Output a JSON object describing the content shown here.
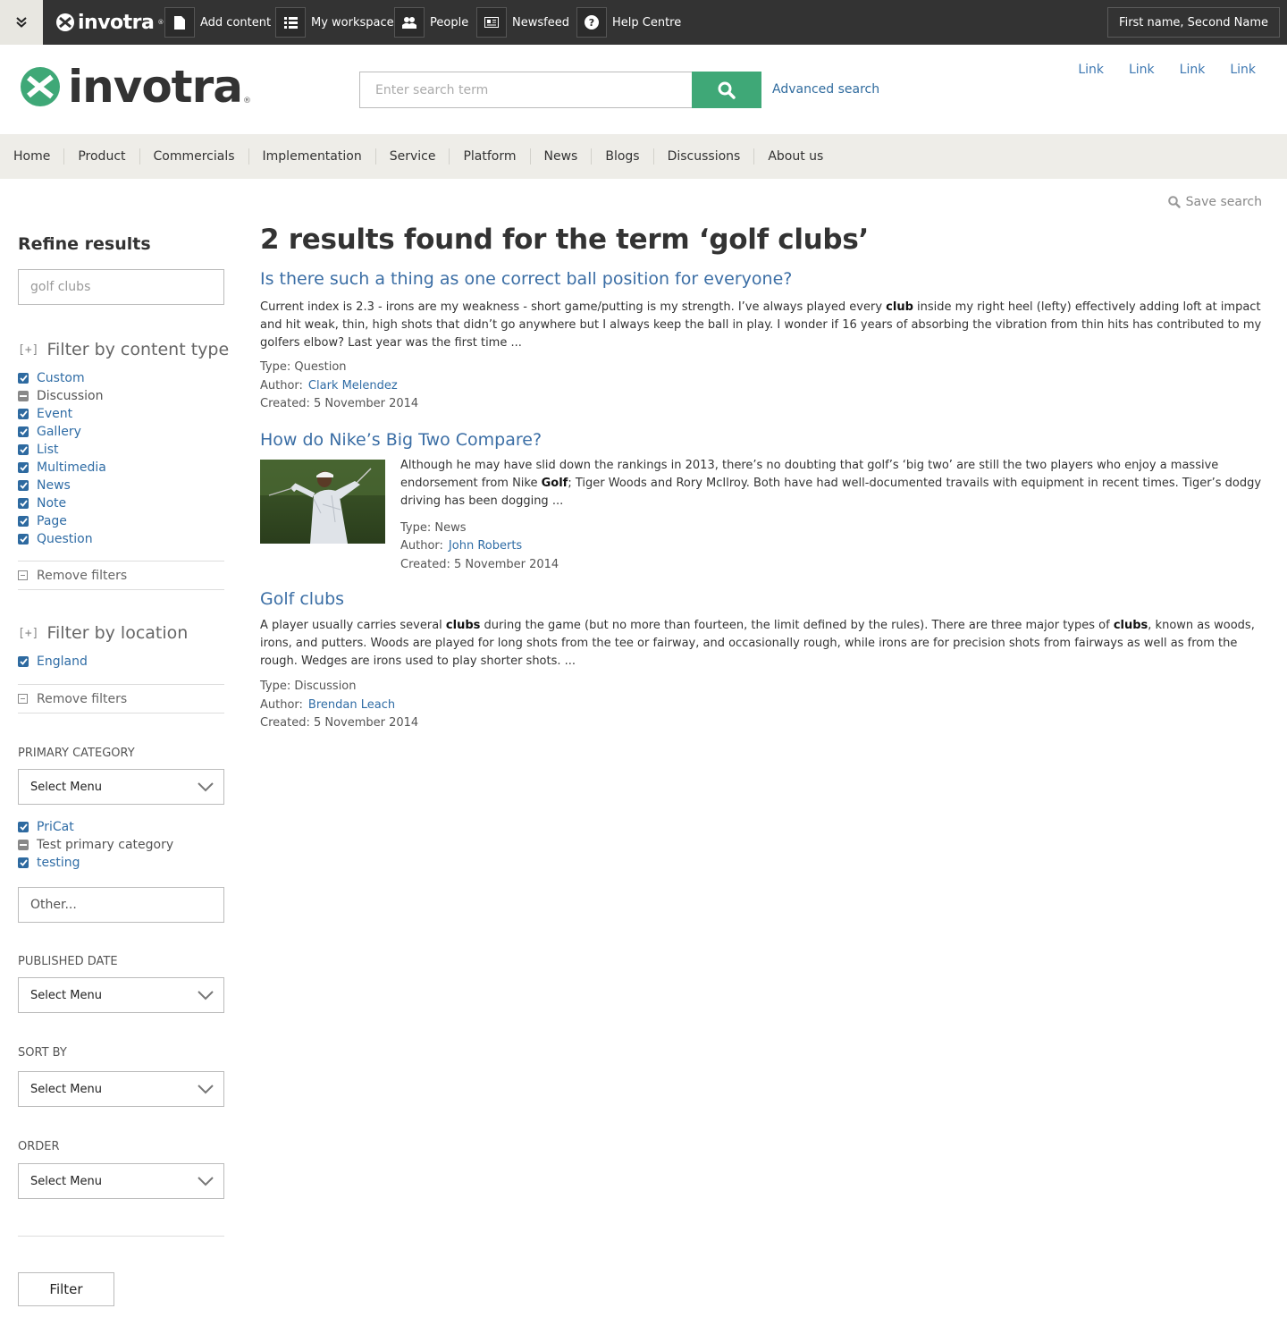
{
  "adminbar": {
    "logo_text": "invotra",
    "buttons": [
      {
        "label": "Add content",
        "icon": "document-icon"
      },
      {
        "label": "My workspace",
        "icon": "list-icon"
      },
      {
        "label": "People",
        "icon": "people-icon"
      },
      {
        "label": "Newsfeed",
        "icon": "newspaper-icon"
      },
      {
        "label": "Help Centre",
        "icon": "help-icon"
      }
    ],
    "user": "First name, Second Name"
  },
  "header": {
    "brand": "invotra",
    "search_placeholder": "Enter search term",
    "advanced_search": "Advanced search",
    "links": [
      "Link",
      "Link",
      "Link",
      "Link"
    ]
  },
  "nav": [
    "Home",
    "Product",
    "Commercials",
    "Implementation",
    "Service",
    "Platform",
    "News",
    "Blogs",
    "Discussions",
    "About us"
  ],
  "save_search": "Save search",
  "sidebar": {
    "title": "Refine results",
    "search_value": "golf clubs",
    "content_type": {
      "toggle": "[+]",
      "heading": "Filter by content type",
      "items": [
        {
          "label": "Custom",
          "state": "checked"
        },
        {
          "label": "Discussion",
          "state": "partial"
        },
        {
          "label": "Event",
          "state": "checked"
        },
        {
          "label": "Gallery",
          "state": "checked"
        },
        {
          "label": "List",
          "state": "checked"
        },
        {
          "label": "Multimedia",
          "state": "checked"
        },
        {
          "label": "News",
          "state": "checked"
        },
        {
          "label": "Note",
          "state": "checked"
        },
        {
          "label": "Page",
          "state": "checked"
        },
        {
          "label": "Question",
          "state": "checked"
        }
      ],
      "remove": "Remove filters"
    },
    "location": {
      "toggle": "[+]",
      "heading": "Filter by location",
      "items": [
        {
          "label": "England",
          "state": "checked"
        }
      ],
      "remove": "Remove filters"
    },
    "primary_category": {
      "label": "PRIMARY CATEGORY",
      "select": "Select Menu",
      "items": [
        {
          "label": "PriCat",
          "state": "checked"
        },
        {
          "label": "Test primary category",
          "state": "partial"
        },
        {
          "label": "testing",
          "state": "checked"
        }
      ],
      "other_placeholder": "Other..."
    },
    "published_date": {
      "label": "PUBLISHED DATE",
      "select": "Select Menu"
    },
    "sort_by": {
      "label": "SORT BY",
      "select": "Select Menu"
    },
    "order": {
      "label": "ORDER",
      "select": "Select Menu"
    },
    "filter_button": "Filter"
  },
  "results": {
    "heading": "2 results found for the term ‘golf clubs’",
    "items": [
      {
        "title": "Is there such a thing as one correct ball position for everyone?",
        "excerpt_before": "Current index is 2.3 - irons are my weakness - short game/putting is my strength. I’ve always played every ",
        "excerpt_bold": "club",
        "excerpt_after": " inside my right heel (lefty) effectively adding loft at impact and hit weak, thin, high shots that didn’t go anywhere but I always keep the ball in play.  I wonder if 16 years of absorbing the vibration from thin hits has contributed to my golfers elbow? Last year was the first time ...",
        "type": "Type: Question",
        "author_label": "Author:",
        "author": "Clark Melendez",
        "created": "Created: 5 November 2014"
      },
      {
        "title": "How do Nike’s Big Two Compare?",
        "excerpt_before": "Although he may have slid down the rankings in 2013, there’s no doubting that golf’s ‘big two’  are still the two players who enjoy a massive endorsement from Nike ",
        "excerpt_bold": "Golf",
        "excerpt_after": "; Tiger Woods and Rory McIlroy. Both have had well-documented travails with equipment in recent times. Tiger’s dodgy driving has been dogging ...",
        "type": "Type: News",
        "author_label": "Author:",
        "author": "John Roberts",
        "created": "Created: 5 November 2014"
      },
      {
        "title": "Golf clubs",
        "excerpt_p1": "A player usually carries several ",
        "excerpt_b1": "clubs",
        "excerpt_p2": " during the game (but no more than fourteen, the limit defined by the rules). There are three major types of ",
        "excerpt_b2": "clubs",
        "excerpt_p3": ", known as woods, irons, and putters. Woods are played for long shots from the tee or fairway, and occasionally rough, while irons are for precision shots from fairways as well as from the rough. Wedges are irons used to play shorter shots. ...",
        "type": "Type: Discussion",
        "author_label": "Author:",
        "author": "Brendan Leach",
        "created": "Created: 5 November 2014"
      }
    ]
  },
  "colors": {
    "accent_green": "#3fa877",
    "link_blue": "#2f6ca5",
    "admin_bar": "#333333",
    "nav_bg": "#eeede8"
  }
}
